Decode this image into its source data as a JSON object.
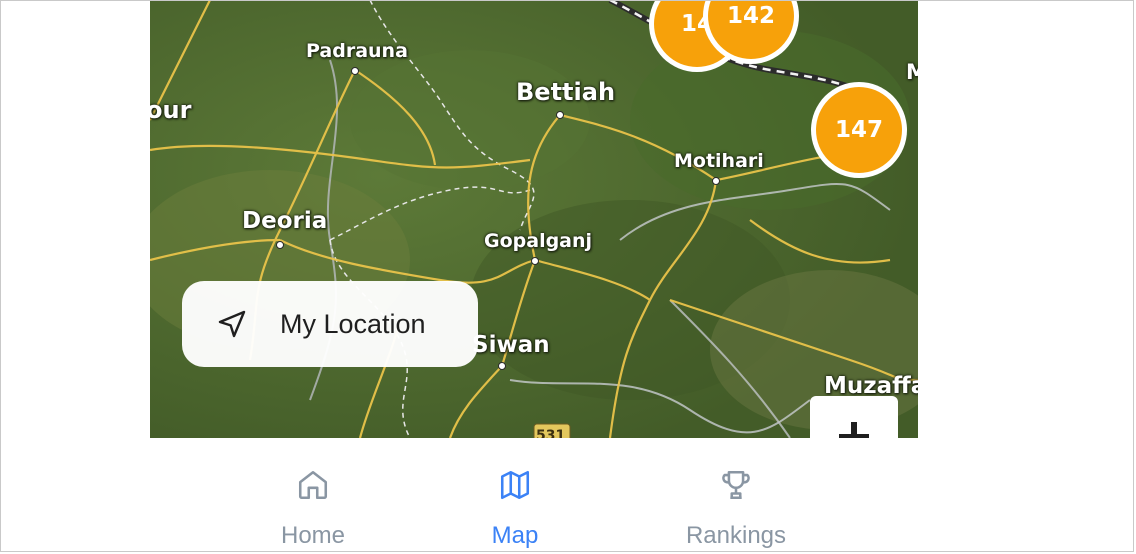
{
  "map": {
    "cities": [
      {
        "name": "Padrauna",
        "id": "padrauna"
      },
      {
        "name": "Bettiah",
        "id": "bettiah"
      },
      {
        "name": "Motihari",
        "id": "motihari"
      },
      {
        "name": "Deoria",
        "id": "deoria"
      },
      {
        "name": "Gopalganj",
        "id": "gopalganj"
      },
      {
        "name": "Siwan",
        "id": "siwan"
      },
      {
        "name": "Muzaffa",
        "id": "muzaffa"
      },
      {
        "name": "our",
        "id": "our-partial"
      },
      {
        "name": "M",
        "id": "m-partial"
      }
    ],
    "highway_shield": "531",
    "clusters": [
      {
        "count": "14",
        "id": "cluster-left"
      },
      {
        "count": "142",
        "id": "cluster-top"
      },
      {
        "count": "147",
        "id": "cluster-right"
      }
    ]
  },
  "my_location": {
    "label": "My Location",
    "icon": "navigation-arrow-icon"
  },
  "zoom": {
    "icon": "plus-icon"
  },
  "nav": {
    "home": {
      "label": "Home",
      "icon": "home-icon"
    },
    "map": {
      "label": "Map",
      "icon": "map-icon"
    },
    "rankings": {
      "label": "Rankings",
      "icon": "trophy-icon"
    }
  },
  "colors": {
    "cluster": "#f7a10a",
    "active": "#3b82f6",
    "inactive": "#8a96a3"
  }
}
